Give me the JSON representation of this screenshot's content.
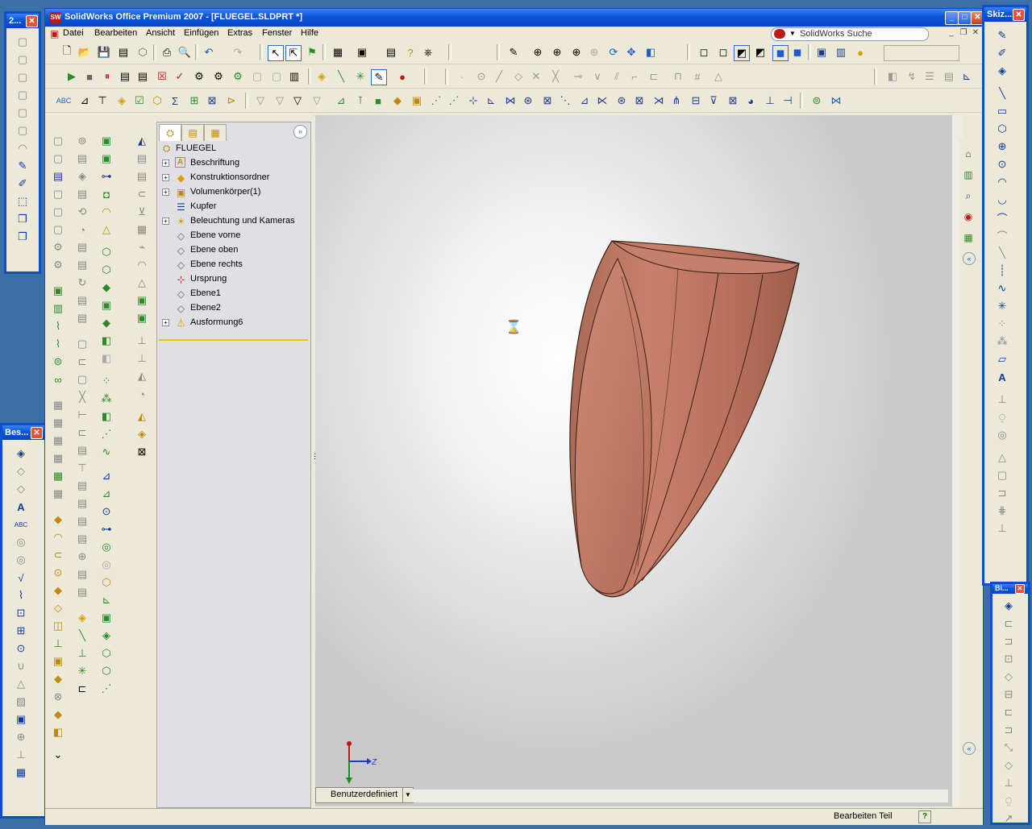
{
  "window": {
    "title": "SolidWorks Office Premium 2007 - [FLUEGEL.SLDPRT *]",
    "app_icon_text": "SW",
    "controls": [
      "_",
      "□",
      "✕"
    ]
  },
  "menu": [
    "Datei",
    "Bearbeiten",
    "Ansicht",
    "Einfügen",
    "Extras",
    "Fenster",
    "Hilfe"
  ],
  "search": {
    "text": "SolidWorks Suche"
  },
  "float_left_top": {
    "title": "2...",
    "close": "✕"
  },
  "float_left_bottom": {
    "title": "Bes...",
    "close": "✕"
  },
  "float_right_top": {
    "title": "Skiz...",
    "close": "✕"
  },
  "float_right_bottom": {
    "title": "Bi...",
    "close": "✕"
  },
  "feature_manager": {
    "root": "FLUEGEL",
    "items": [
      {
        "label": "Beschriftung",
        "expandable": true,
        "icon": "annotation-icon"
      },
      {
        "label": "Konstruktionsordner",
        "expandable": true,
        "icon": "design-binder-icon"
      },
      {
        "label": "Volumenkörper(1)",
        "expandable": true,
        "icon": "solid-bodies-icon"
      },
      {
        "label": "Kupfer",
        "expandable": false,
        "icon": "material-icon"
      },
      {
        "label": "Beleuchtung und Kameras",
        "expandable": true,
        "icon": "lights-icon"
      },
      {
        "label": "Ebene vorne",
        "expandable": false,
        "icon": "plane-icon"
      },
      {
        "label": "Ebene oben",
        "expandable": false,
        "icon": "plane-icon"
      },
      {
        "label": "Ebene rechts",
        "expandable": false,
        "icon": "plane-icon"
      },
      {
        "label": "Ursprung",
        "expandable": false,
        "icon": "origin-icon"
      },
      {
        "label": "Ebene1",
        "expandable": false,
        "icon": "plane-icon"
      },
      {
        "label": "Ebene2",
        "expandable": false,
        "icon": "plane-icon"
      },
      {
        "label": "Ausformung6",
        "expandable": true,
        "icon": "loft-icon"
      }
    ]
  },
  "viewport": {
    "view_combo": "Benutzerdefiniert",
    "triad_axis_label": "Z",
    "part_color": "#c9806a"
  },
  "status": {
    "text": "Bearbeiten Teil",
    "help": "?"
  },
  "colors": {
    "xp_blue": "#0b4fd0",
    "face": "#ece9d8",
    "rollback": "#e6c800"
  }
}
